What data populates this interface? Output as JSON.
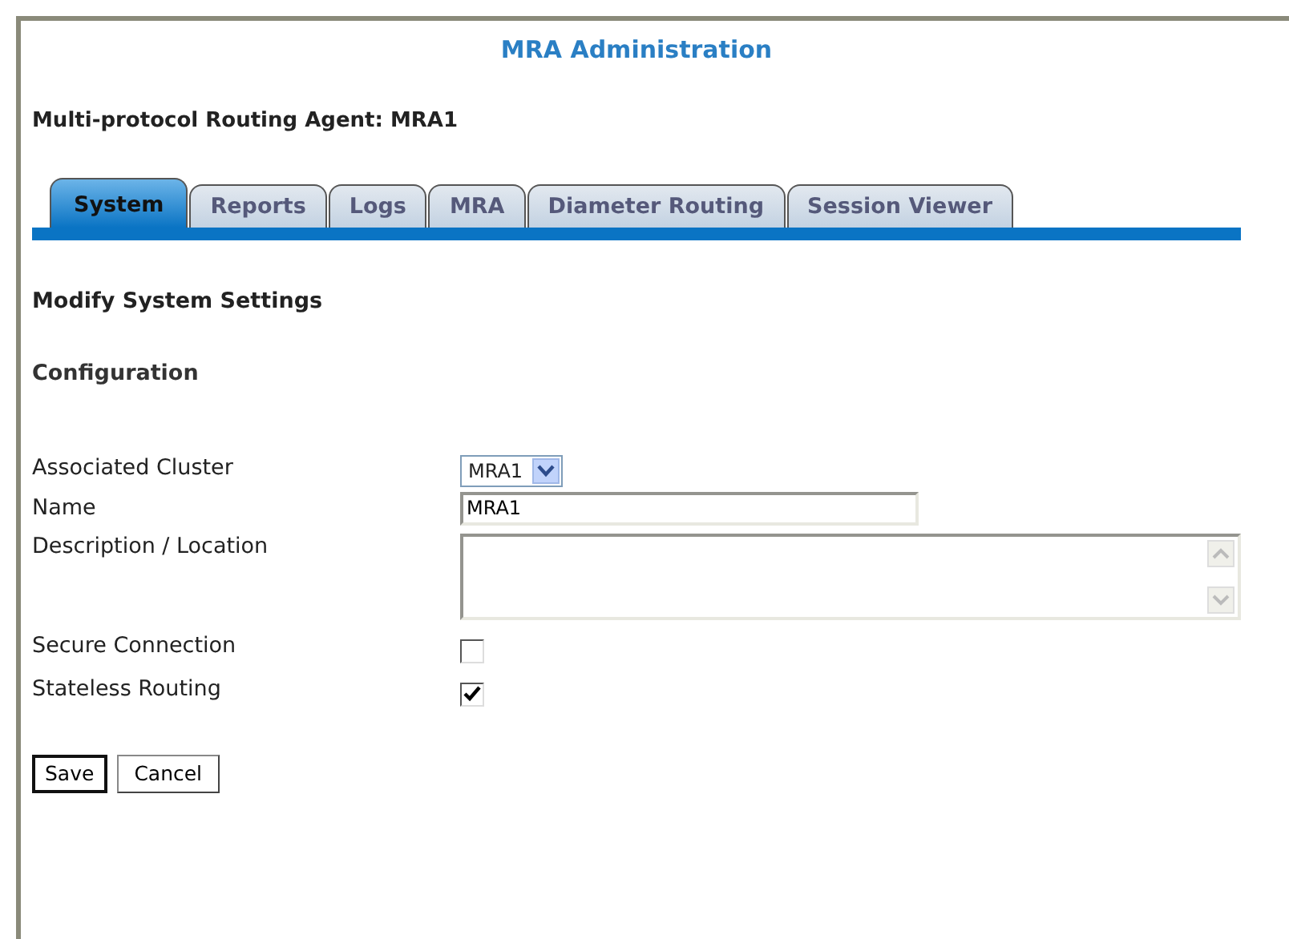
{
  "page_title": "MRA Administration",
  "agent_heading": "Multi-protocol Routing Agent: MRA1",
  "tabs": [
    {
      "label": "System",
      "selected": true
    },
    {
      "label": "Reports",
      "selected": false
    },
    {
      "label": "Logs",
      "selected": false
    },
    {
      "label": "MRA",
      "selected": false
    },
    {
      "label": "Diameter Routing",
      "selected": false
    },
    {
      "label": "Session Viewer",
      "selected": false
    }
  ],
  "section_title": "Modify System Settings",
  "subsection_title": "Configuration",
  "fields": [
    {
      "kind": "select",
      "label": "Associated Cluster",
      "value": "MRA1"
    },
    {
      "kind": "text",
      "label": "Name",
      "value": "MRA1"
    },
    {
      "kind": "textarea",
      "label": "Description / Location"
    },
    {
      "kind": "checkbox",
      "label": "Secure Connection",
      "checked": false
    },
    {
      "kind": "checkbox",
      "label": "Stateless Routing",
      "checked": true
    }
  ],
  "buttons": [
    {
      "label": "Save",
      "default": true
    },
    {
      "label": "Cancel",
      "default": false
    }
  ]
}
